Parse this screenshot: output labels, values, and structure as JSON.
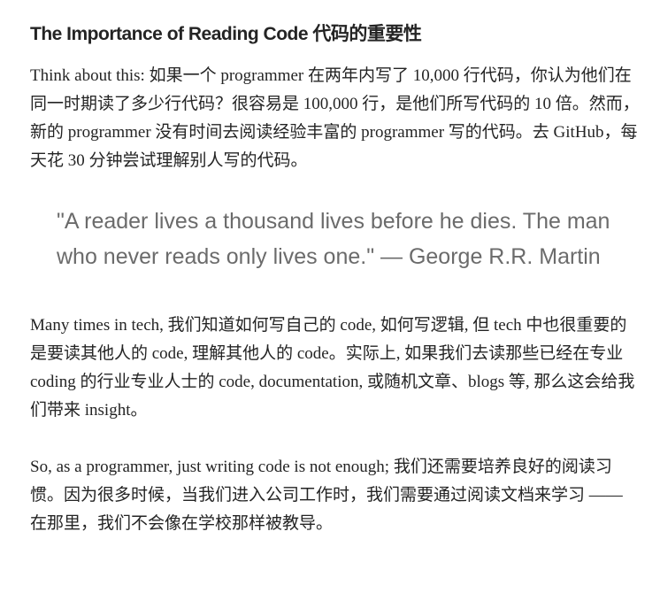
{
  "article": {
    "heading": "The Importance of Reading Code 代码的重要性",
    "para1": "Think about this: 如果一个 programmer 在两年内写了 10,000 行代码，你认为他们在同一时期读了多少行代码？很容易是 100,000 行，是他们所写代码的 10 倍。然而，新的 programmer 没有时间去阅读经验丰富的 programmer 写的代码。去 GitHub，每天花 30 分钟尝试理解别人写的代码。",
    "quote": "\"A reader lives a thousand lives before he dies. The man who never reads only lives one.\" — George R.R. Martin",
    "para2": "Many times in tech, 我们知道如何写自己的 code, 如何写逻辑, 但 tech 中也很重要的是要读其他人的 code, 理解其他人的 code。实际上, 如果我们去读那些已经在专业 coding 的行业专业人士的 code, documentation, 或随机文章、blogs 等, 那么这会给我们带来 insight。",
    "para3": "So, as a programmer, just writing code is not enough; 我们还需要培养良好的阅读习惯。因为很多时候，当我们进入公司工作时，我们需要通过阅读文档来学习 —— 在那里，我们不会像在学校那样被教导。"
  }
}
